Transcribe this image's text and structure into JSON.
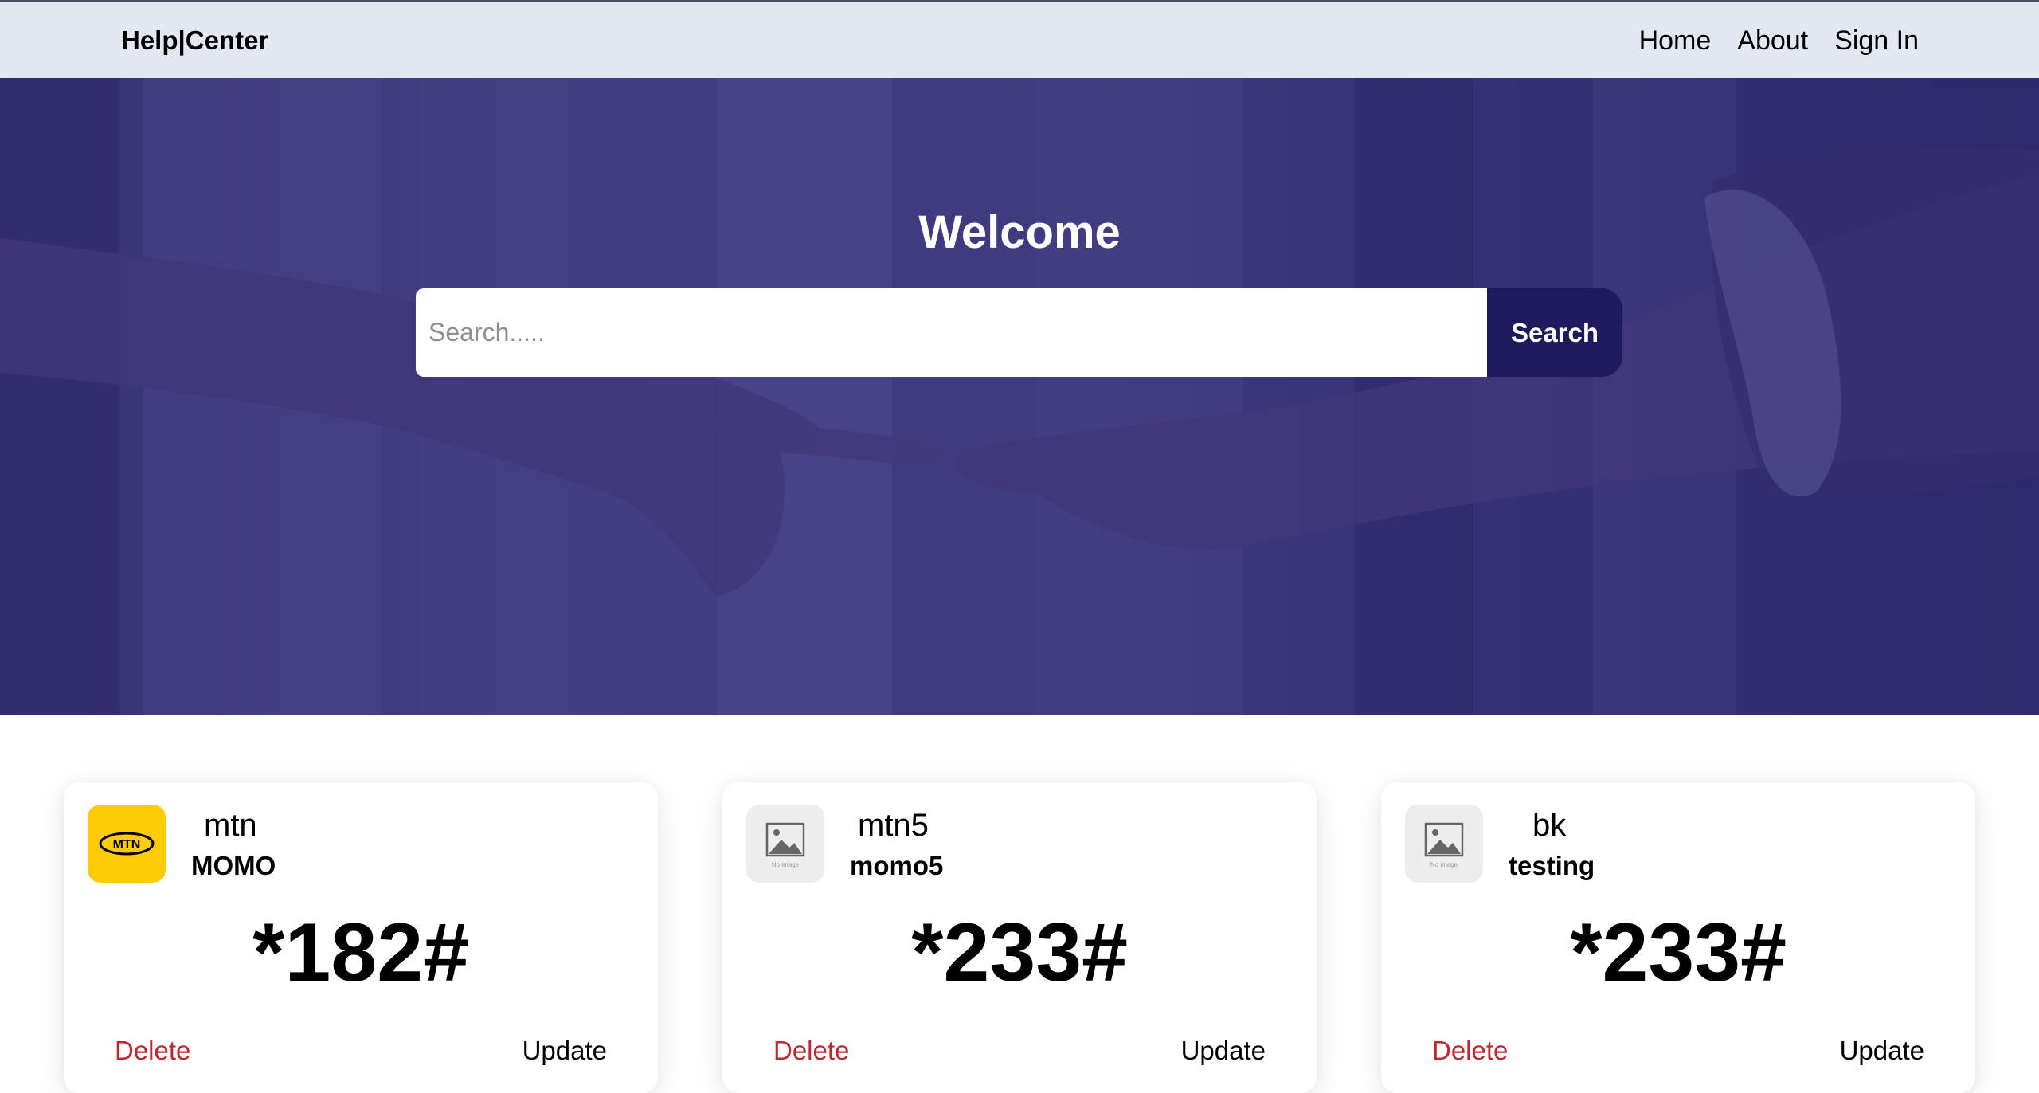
{
  "navbar": {
    "brand": "Help|Center",
    "links": [
      "Home",
      "About",
      "Sign In"
    ]
  },
  "hero": {
    "title": "Welcome",
    "search_placeholder": "Search.....",
    "search_button": "Search"
  },
  "cards": [
    {
      "name": "mtn",
      "subtitle": "MOMO",
      "code": "*182#",
      "logo": "mtn-logo",
      "logo_text": "MTN",
      "delete_label": "Delete",
      "update_label": "Update"
    },
    {
      "name": "mtn5",
      "subtitle": "momo5",
      "code": "*233#",
      "logo": "no-image-icon",
      "logo_text": "No image",
      "delete_label": "Delete",
      "update_label": "Update"
    },
    {
      "name": "bk",
      "subtitle": "testing",
      "code": "*233#",
      "logo": "no-image-icon",
      "logo_text": "No image",
      "delete_label": "Delete",
      "update_label": "Update"
    }
  ],
  "colors": {
    "navbar_bg": "#e3e8f0",
    "hero_overlay": "#3c3775",
    "search_button": "#1f1a5e",
    "delete_text": "#c0262d",
    "mtn_yellow": "#ffcb05"
  }
}
